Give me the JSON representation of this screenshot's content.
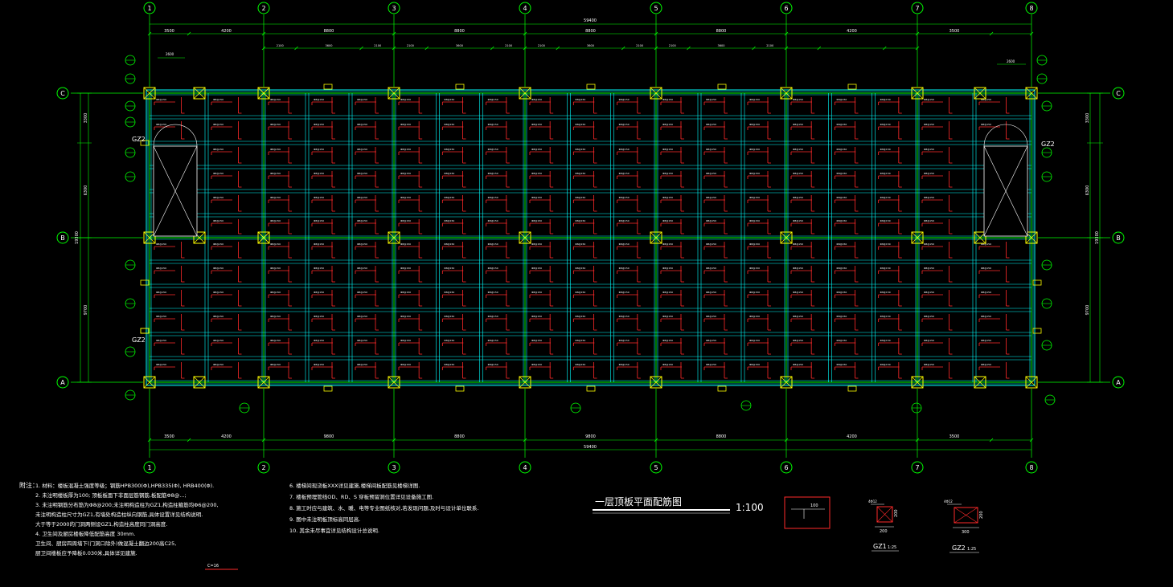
{
  "colors": {
    "background": "#000000",
    "axis": "#00ff00",
    "beam": "#00ffff",
    "rebar": "#ff2a2a",
    "column": "#ffff00",
    "text": "#ffffff"
  },
  "grid": {
    "columns": [
      "1",
      "2",
      "3",
      "4",
      "5",
      "6",
      "7",
      "8"
    ],
    "rows": [
      "C",
      "B",
      "A"
    ]
  },
  "dimensions": {
    "top_total": "59400",
    "bottom_total": "59400",
    "top_segments": [
      "3500",
      "4200",
      "8800",
      "8800",
      "8800",
      "8800",
      "4200",
      "3500"
    ],
    "bottom_segments": [
      "3500",
      "4200",
      "9800",
      "8800",
      "9800",
      "8800",
      "4200",
      "3500"
    ],
    "left_vertical": [
      "3300",
      "6300",
      "9700"
    ],
    "right_vertical": [
      "3300",
      "6300",
      "9700"
    ],
    "left_total": "19300",
    "right_total": "19300",
    "sub_top": [
      "2100",
      "3600",
      "2100",
      "2100",
      "3600",
      "2100",
      "2100",
      "3600",
      "2100",
      "2100",
      "3600",
      "2100"
    ],
    "stair_top": "2600"
  },
  "labels": {
    "gz2_left_upper": "GZ2",
    "gz2_left_lower": "GZ2",
    "gz2_right": "GZ2"
  },
  "title": {
    "main": "一层顶板平面配筋图",
    "scale": "1:100"
  },
  "details": {
    "gz1_label": "GZ1",
    "gz1_scale": "1:25",
    "gz2_label": "GZ2",
    "gz2_scale": "1:25",
    "gz1_dim": "200",
    "gz2_dim": "300",
    "side_dim": "200",
    "detail_box_label": "100"
  },
  "notes": {
    "heading": "附注：",
    "col1": [
      "1. 材料：楼板混凝土强度等级；钢筋HPB300(Φ),HPB335(Φ), HRB400(Φ).",
      "2. 未注明楼板厚为100;    顶板板面下非面层筋钢筋,板配筋Φ8@...;",
      "3. 未注明钢筋分布筋为Φ8@200;未注明构造柱为GZ1,构造柱箍筋均Φ6@200,",
      "   未注明构造柱尺寸为GZ1,有墙处构造柱纵向钢筋,具体设置详见结构说明.",
      "   大于等于2000的门洞两侧设GZ1,构造柱高度同门洞高度.",
      "4. 卫生间及厨房楼板降低配筋高度 30mm.",
      "   卫生间、厨房四周墙下(门洞口除外)做混凝土翻边200高C25,",
      "   厨卫间楼板应予降板0.030米,具体详见建施."
    ],
    "col2": [
      "6. 楼梯间现浇板XXX详见建施,楼梯间板配筋见楼梯详图.",
      "7. 楼板预埋管线OD、RD、S 穿板预留洞位置详见设备施工图.",
      "8. 施工时应与建筑、水、暖、电等专业图纸核对,若发现问题,及时与设计单位联系.",
      "9. 图中未注明板顶标高同层高.",
      "10. 其余未尽事宜详见结构设计总说明."
    ],
    "bottom_tag": "C=16"
  }
}
